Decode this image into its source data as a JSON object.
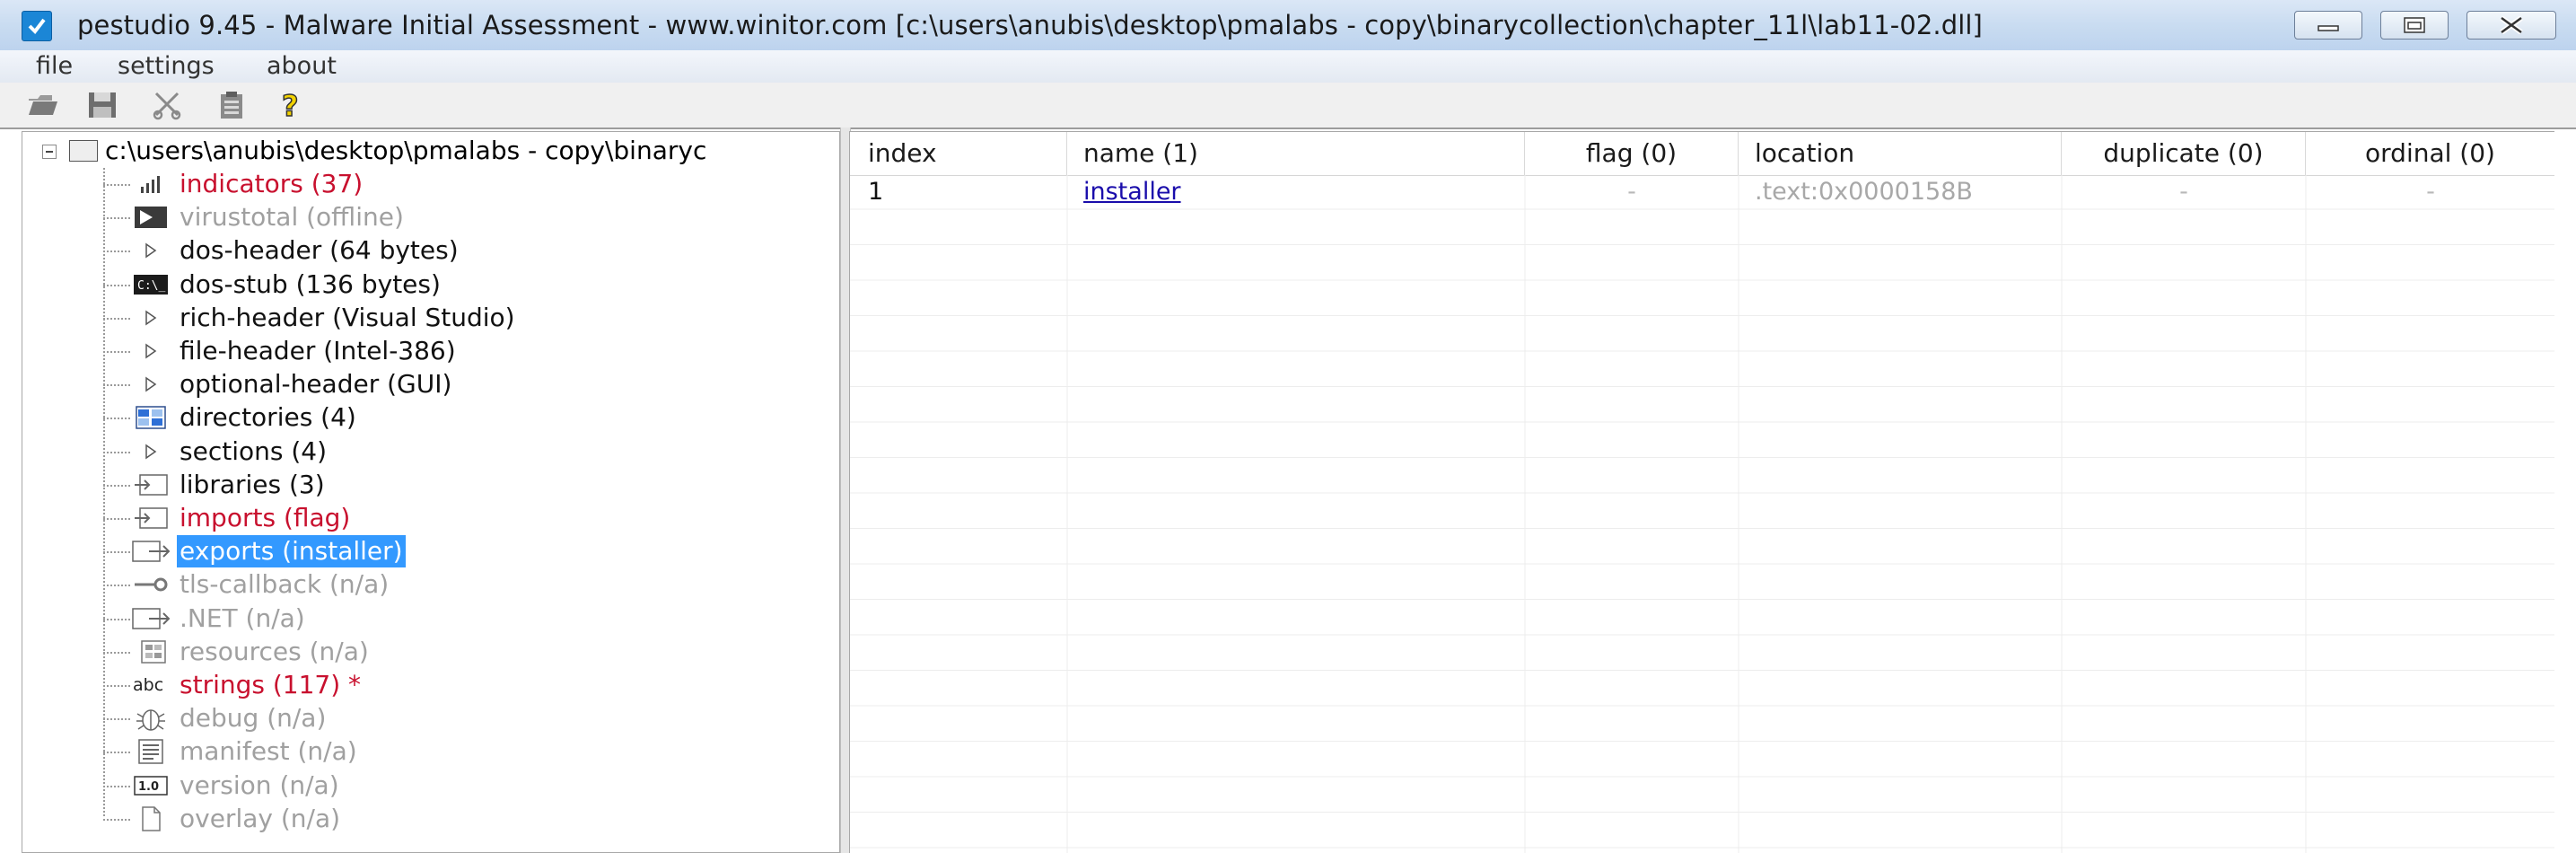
{
  "window": {
    "title": "pestudio 9.45 - Malware Initial Assessment - www.winitor.com [c:\\users\\anubis\\desktop\\pmalabs - copy\\binarycollection\\chapter_11l\\lab11-02.dll]"
  },
  "menu": {
    "file": "file",
    "settings": "settings",
    "about": "about"
  },
  "toolbar": {
    "icons": [
      "folder-open-icon",
      "save-icon",
      "cut-icon",
      "clipboard-icon",
      "help-icon"
    ]
  },
  "tree": {
    "root": "c:\\users\\anubis\\desktop\\pmalabs - copy\\binaryc",
    "items": [
      {
        "label": "indicators (37)",
        "style": "red",
        "icon": "bar-chart-icon"
      },
      {
        "label": "virustotal (offline)",
        "style": "gray",
        "icon": "virustotal-icon"
      },
      {
        "label": "dos-header (64 bytes)",
        "style": "black",
        "icon": "triangle-right-icon"
      },
      {
        "label": "dos-stub (136 bytes)",
        "style": "black",
        "icon": "console-icon"
      },
      {
        "label": "rich-header (Visual Studio)",
        "style": "black",
        "icon": "triangle-right-icon"
      },
      {
        "label": "file-header (Intel-386)",
        "style": "black",
        "icon": "triangle-right-icon"
      },
      {
        "label": "optional-header (GUI)",
        "style": "black",
        "icon": "triangle-right-icon"
      },
      {
        "label": "directories (4)",
        "style": "black",
        "icon": "directories-icon"
      },
      {
        "label": "sections (4)",
        "style": "black",
        "icon": "triangle-right-icon"
      },
      {
        "label": "libraries (3)",
        "style": "black",
        "icon": "library-icon"
      },
      {
        "label": "imports (flag)",
        "style": "red",
        "icon": "import-icon"
      },
      {
        "label": "exports (installer)",
        "style": "selected",
        "icon": "export-icon"
      },
      {
        "label": "tls-callback (n/a)",
        "style": "gray",
        "icon": "key-icon"
      },
      {
        "label": ".NET (n/a)",
        "style": "gray",
        "icon": "export-icon"
      },
      {
        "label": "resources (n/a)",
        "style": "gray",
        "icon": "resources-icon"
      },
      {
        "label": "strings (117) *",
        "style": "red",
        "icon": "abc-icon"
      },
      {
        "label": "debug (n/a)",
        "style": "gray",
        "icon": "bug-icon"
      },
      {
        "label": "manifest (n/a)",
        "style": "gray",
        "icon": "manifest-icon"
      },
      {
        "label": "version (n/a)",
        "style": "gray",
        "icon": "version-icon"
      },
      {
        "label": "overlay (n/a)",
        "style": "gray",
        "icon": "page-icon"
      }
    ]
  },
  "table": {
    "columns": [
      "index",
      "name (1)",
      "flag (0)",
      "location",
      "duplicate (0)",
      "ordinal (0)"
    ],
    "rows": [
      {
        "index": "1",
        "name": "installer",
        "flag": "-",
        "location": ".text:0x0000158B",
        "duplicate": "-",
        "ordinal": "-"
      }
    ]
  },
  "colors": {
    "red": "#c8102e",
    "gray": "#a0a0a0",
    "selected": "#3399ff",
    "link": "#1a0dab"
  }
}
